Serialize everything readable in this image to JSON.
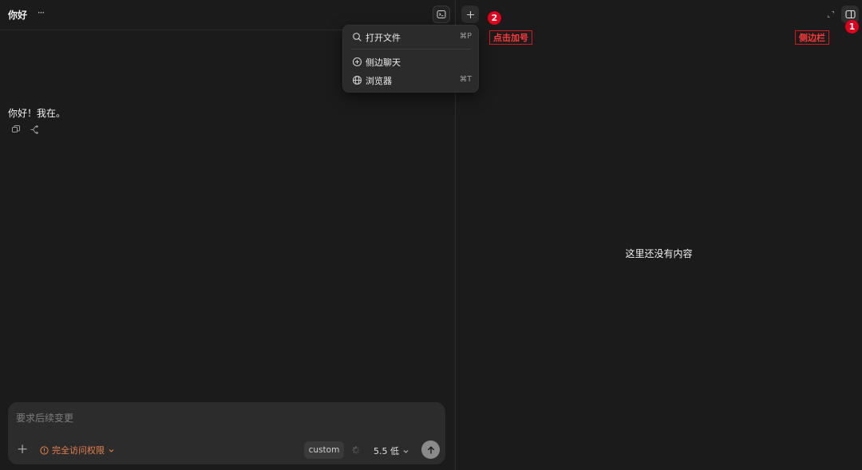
{
  "chat": {
    "title": "你好",
    "more_glyph": "···",
    "message": "你好！我在。"
  },
  "menu": {
    "items": [
      {
        "label": "打开文件",
        "shortcut": "⌘P",
        "icon": "search-icon"
      },
      {
        "label": "侧边聊天",
        "shortcut": "",
        "icon": "plus-circle-icon"
      },
      {
        "label": "浏览器",
        "shortcut": "⌘T",
        "icon": "globe-icon"
      }
    ]
  },
  "composer": {
    "placeholder": "要求后续变更",
    "add_glyph": "+",
    "permission_label": "完全访问权限",
    "custom_label": "custom",
    "model_label": "5.5 低"
  },
  "right_panel": {
    "empty_text": "这里还没有内容"
  },
  "annotations": {
    "sidebar": {
      "number": "1",
      "label": "侧边栏"
    },
    "plus": {
      "number": "2",
      "label": "点击加号"
    }
  },
  "colors": {
    "background": "#1b1b1b",
    "accent_warning": "#e8814a",
    "annotation_red": "#e0001b"
  }
}
